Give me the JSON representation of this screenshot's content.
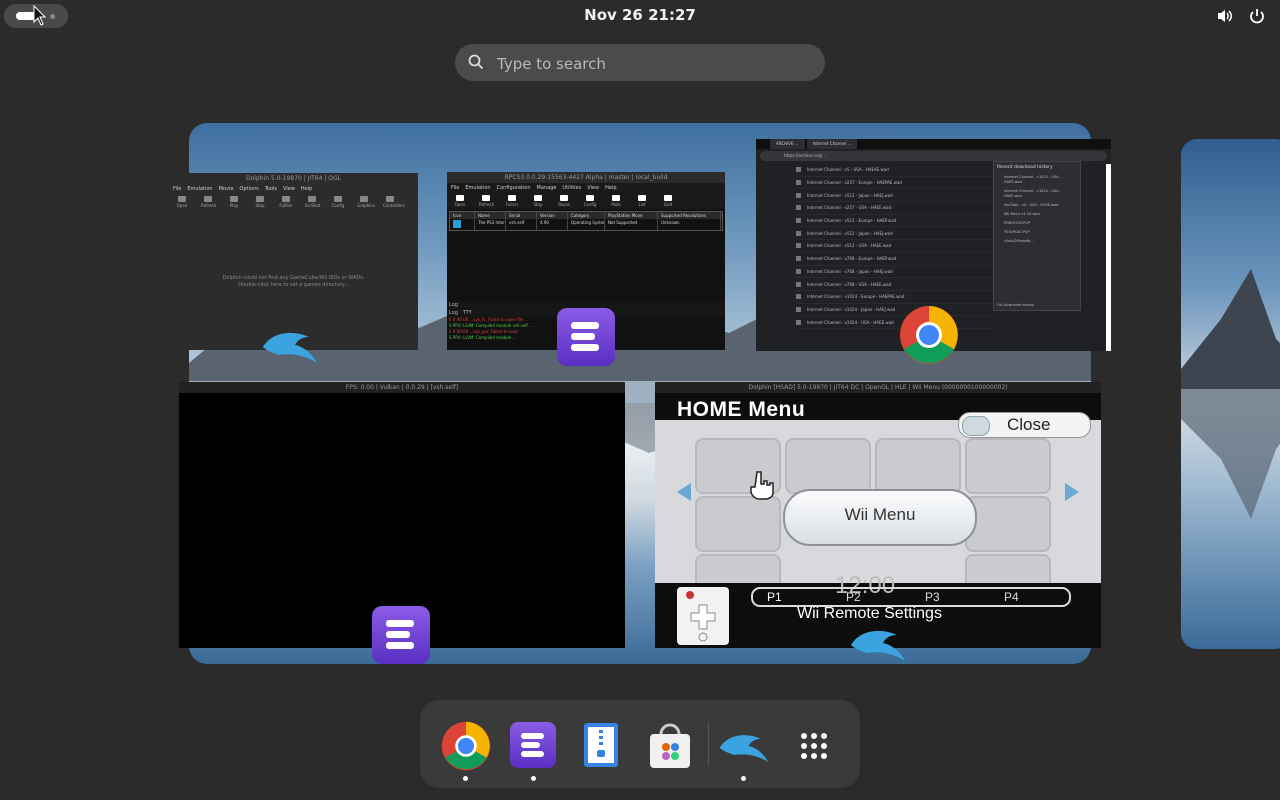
{
  "topbar": {
    "clock": "Nov 26  21:27",
    "icons": [
      "volume-icon",
      "power-icon"
    ]
  },
  "search": {
    "placeholder": "Type to search"
  },
  "windows": {
    "dolphin_main": {
      "title": "Dolphin 5.0-19870 | JIT64 | OGL",
      "menu": [
        "File",
        "Emulation",
        "Movie",
        "Options",
        "Tools",
        "View",
        "Help"
      ],
      "tools": [
        "Open",
        "Refresh",
        "Play",
        "Stop",
        "FullScr",
        "ScrShot",
        "Config",
        "Graphics",
        "Controllers"
      ],
      "empty_msg_1": "Dolphin could not find any GameCube/Wii ISOs or WADs.",
      "empty_msg_2": "Double-click here to set a games directory..."
    },
    "rpcs3_main": {
      "title": "RPCS3 0.0.29-15563-4427 Alpha | master | local_build",
      "menu": [
        "File",
        "Emulation",
        "Configuration",
        "Manage",
        "Utilities",
        "View",
        "Help"
      ],
      "tools": [
        "Open",
        "Refresh",
        "Fullscr",
        "Stop",
        "Pause",
        "Config",
        "Pads",
        "List",
        "Grid"
      ],
      "columns": [
        "Icon",
        "Name",
        "Serial",
        "Version",
        "Category",
        "PlayStation Move",
        "Supported Resolutions"
      ],
      "row": [
        "",
        "The PS3 Interface ...",
        "vsh.self",
        "4.90",
        "Operating System",
        "Not Supported",
        "Unknown"
      ],
      "log_title": "Log",
      "log_tabs": [
        "Log",
        "TTY"
      ],
      "log_lines": [
        "E 0:00:00 ...sys_fs: Failed to open file ...",
        "S PPU: LLVM: Compiled module vsh.self ...",
        "E 0:00:00 ...sys_prx: Failed to load ...",
        "S PPU: LLVM: Compiled module ..."
      ]
    },
    "chrome": {
      "tabs": [
        "ARCHIVE ...",
        "Internet Channel ..."
      ],
      "url": "https://archive.org/...",
      "rows": [
        "Internet Channel - v5 - USA - HAEAE.wad",
        "Internet Channel - v257 - Europe - HAEPAE.wad",
        "Internet Channel - v512 - Japan - HAEJ.wad",
        "Internet Channel - v257 - USA - HAEE.wad",
        "Internet Channel - v512 - Europe - HAEP.wad",
        "Internet Channel - v512 - Japan - HAEJ.wad",
        "Internet Channel - v512 - USA - HAEE.wad",
        "Internet Channel - v768 - Europe - HAEP.wad",
        "Internet Channel - v768 - Japan - HAEJ.wad",
        "Internet Channel - v768 - USA - HAEE.wad",
        "Internet Channel - v1024 - Europe - HAEPAE.wad",
        "Internet Channel - v1024 - Japan - HAEJ.wad",
        "Internet Channel - v1024 - USA - HAEE.wad"
      ],
      "popup_title": "Recent download history",
      "popup_items": [
        "Internet Channel - v1024 - USA - HAEE.wad",
        "Internet Channel - v1024 - USA - HAEE.wad",
        "YouTube - v5 - USA - HCRE.wad",
        "Wii Menu v4.3U.wad",
        "PDRUFCAT.PUP",
        "PS3UPDAT.PUP",
        "c0a4d2f0eeefb..."
      ],
      "popup_footer": "Full download history"
    },
    "rpcs3_game": {
      "title": "FPS: 0.00 | Vulkan | 0.0.29 | [vsh.self]"
    },
    "dolphin_game": {
      "title": "Dolphin [HSAD] 5.0-19870 | JIT64 DC | OpenGL | HLE | Wii Menu (0000000100000002)",
      "home_menu": "HOME Menu",
      "close": "Close",
      "wii_menu": "Wii Menu",
      "players": [
        "P1",
        "P2",
        "P3",
        "P4"
      ],
      "remote_settings": "Wii Remote Settings",
      "ghost_clock": "12:00"
    }
  },
  "dash": {
    "apps": [
      {
        "name": "Google Chrome",
        "running": true
      },
      {
        "name": "RPCS3",
        "running": true
      },
      {
        "name": "Text Editor",
        "running": false
      },
      {
        "name": "Software",
        "running": false
      },
      {
        "name": "Dolphin Emulator",
        "running": true
      },
      {
        "name": "Show Apps",
        "running": false
      }
    ]
  }
}
